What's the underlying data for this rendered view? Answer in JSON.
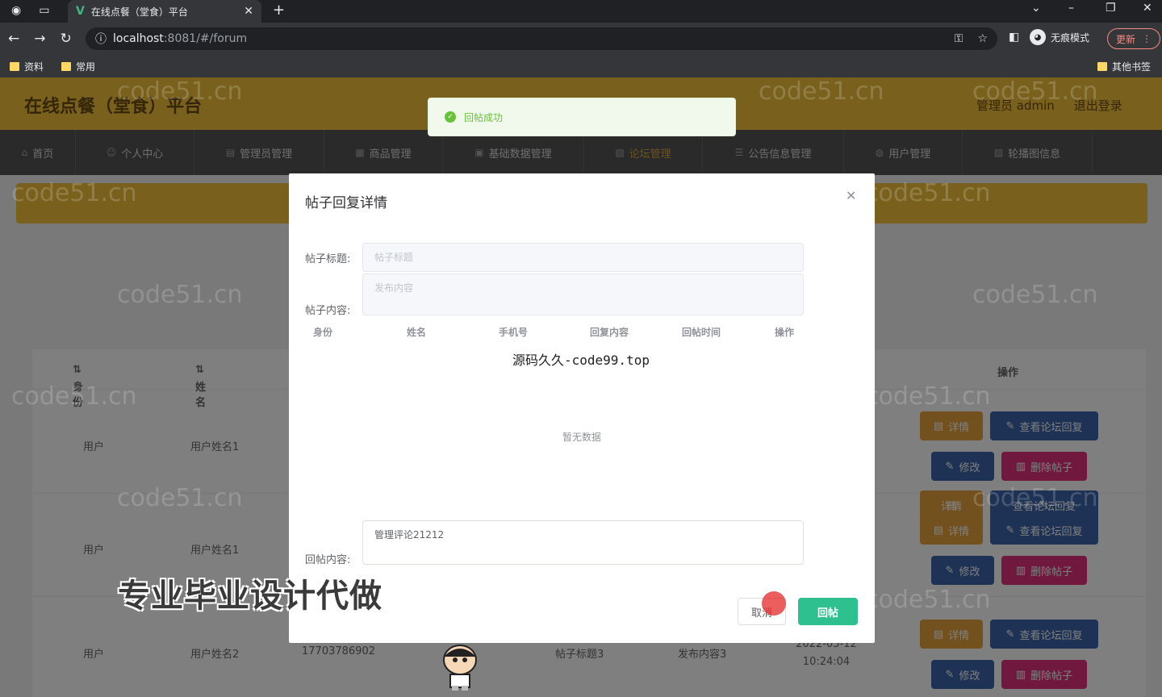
{
  "browser": {
    "tab_title": "在线点餐（堂食）平台",
    "url_host": "localhost",
    "url_path": ":8081/#/forum",
    "incognito_label": "无痕模式",
    "update_label": "更新",
    "bookmarks": [
      "资料",
      "常用"
    ],
    "other_bookmarks": "其他书签"
  },
  "header": {
    "brand": "在线点餐（堂食）平台",
    "admin_label": "管理员 admin",
    "logout_label": "退出登录"
  },
  "menu": [
    {
      "label": "首页",
      "icon": "home-icon"
    },
    {
      "label": "个人中心",
      "icon": "user-icon"
    },
    {
      "label": "管理员管理",
      "icon": "admin-icon"
    },
    {
      "label": "商品管理",
      "icon": "goods-icon"
    },
    {
      "label": "基础数据管理",
      "icon": "data-icon"
    },
    {
      "label": "论坛管理",
      "icon": "forum-icon"
    },
    {
      "label": "公告信息管理",
      "icon": "notice-icon"
    },
    {
      "label": "用户管理",
      "icon": "users-icon"
    },
    {
      "label": "轮播图信息",
      "icon": "carousel-icon"
    }
  ],
  "table": {
    "headers": {
      "identity": "身份",
      "name": "姓名",
      "actions": "操作"
    },
    "rows": [
      {
        "identity": "用户",
        "name": "用户姓名1",
        "phone": "",
        "title": "",
        "content": "",
        "time": ""
      },
      {
        "identity": "用户",
        "name": "用户姓名1",
        "phone": "",
        "title": "",
        "content": "",
        "time": ""
      },
      {
        "identity": "用户",
        "name": "用户姓名2",
        "phone": "17703786902",
        "title": "帖子标题3",
        "content": "发布内容3",
        "time": "2022-05-12 10:24:04"
      }
    ],
    "buttons": {
      "detail": "详情",
      "view_replies": "查看论坛回复",
      "edit": "修改",
      "delete": "删除帖子"
    }
  },
  "toast": {
    "message": "回帖成功"
  },
  "dialog": {
    "title": "帖子回复详情",
    "post_title_label": "帖子标题:",
    "post_title_placeholder": "帖子标题",
    "post_content_label": "帖子内容:",
    "post_content_placeholder": "发布内容",
    "columns": [
      "身份",
      "姓名",
      "手机号",
      "回复内容",
      "回帖时间",
      "操作"
    ],
    "watermark_text": "源码久久-code99.top",
    "empty_text": "暂无数据",
    "reply_label": "回帖内容:",
    "reply_value": "管理评论21212",
    "cancel_label": "取消",
    "submit_label": "回帖"
  },
  "overlay": {
    "promo_text": "专业毕业设计代做",
    "watermark": "code51.cn"
  }
}
